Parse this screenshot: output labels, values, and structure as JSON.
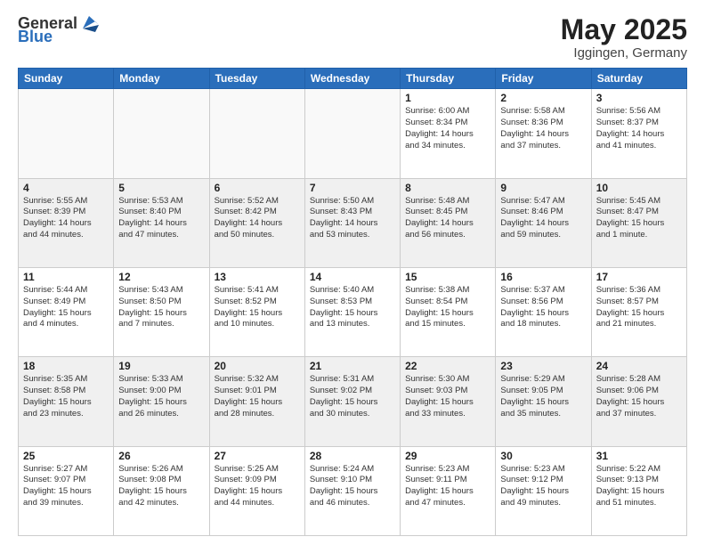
{
  "header": {
    "logo_general": "General",
    "logo_blue": "Blue",
    "title": "May 2025",
    "location": "Iggingen, Germany"
  },
  "days_of_week": [
    "Sunday",
    "Monday",
    "Tuesday",
    "Wednesday",
    "Thursday",
    "Friday",
    "Saturday"
  ],
  "weeks": [
    [
      {
        "day": "",
        "empty": true
      },
      {
        "day": "",
        "empty": true
      },
      {
        "day": "",
        "empty": true
      },
      {
        "day": "",
        "empty": true
      },
      {
        "day": "1",
        "sunrise": "6:00 AM",
        "sunset": "8:34 PM",
        "daylight": "14 hours and 34 minutes."
      },
      {
        "day": "2",
        "sunrise": "5:58 AM",
        "sunset": "8:36 PM",
        "daylight": "14 hours and 37 minutes."
      },
      {
        "day": "3",
        "sunrise": "5:56 AM",
        "sunset": "8:37 PM",
        "daylight": "14 hours and 41 minutes."
      }
    ],
    [
      {
        "day": "4",
        "sunrise": "5:55 AM",
        "sunset": "8:39 PM",
        "daylight": "14 hours and 44 minutes."
      },
      {
        "day": "5",
        "sunrise": "5:53 AM",
        "sunset": "8:40 PM",
        "daylight": "14 hours and 47 minutes."
      },
      {
        "day": "6",
        "sunrise": "5:52 AM",
        "sunset": "8:42 PM",
        "daylight": "14 hours and 50 minutes."
      },
      {
        "day": "7",
        "sunrise": "5:50 AM",
        "sunset": "8:43 PM",
        "daylight": "14 hours and 53 minutes."
      },
      {
        "day": "8",
        "sunrise": "5:48 AM",
        "sunset": "8:45 PM",
        "daylight": "14 hours and 56 minutes."
      },
      {
        "day": "9",
        "sunrise": "5:47 AM",
        "sunset": "8:46 PM",
        "daylight": "14 hours and 59 minutes."
      },
      {
        "day": "10",
        "sunrise": "5:45 AM",
        "sunset": "8:47 PM",
        "daylight": "15 hours and 1 minute."
      }
    ],
    [
      {
        "day": "11",
        "sunrise": "5:44 AM",
        "sunset": "8:49 PM",
        "daylight": "15 hours and 4 minutes."
      },
      {
        "day": "12",
        "sunrise": "5:43 AM",
        "sunset": "8:50 PM",
        "daylight": "15 hours and 7 minutes."
      },
      {
        "day": "13",
        "sunrise": "5:41 AM",
        "sunset": "8:52 PM",
        "daylight": "15 hours and 10 minutes."
      },
      {
        "day": "14",
        "sunrise": "5:40 AM",
        "sunset": "8:53 PM",
        "daylight": "15 hours and 13 minutes."
      },
      {
        "day": "15",
        "sunrise": "5:38 AM",
        "sunset": "8:54 PM",
        "daylight": "15 hours and 15 minutes."
      },
      {
        "day": "16",
        "sunrise": "5:37 AM",
        "sunset": "8:56 PM",
        "daylight": "15 hours and 18 minutes."
      },
      {
        "day": "17",
        "sunrise": "5:36 AM",
        "sunset": "8:57 PM",
        "daylight": "15 hours and 21 minutes."
      }
    ],
    [
      {
        "day": "18",
        "sunrise": "5:35 AM",
        "sunset": "8:58 PM",
        "daylight": "15 hours and 23 minutes."
      },
      {
        "day": "19",
        "sunrise": "5:33 AM",
        "sunset": "9:00 PM",
        "daylight": "15 hours and 26 minutes."
      },
      {
        "day": "20",
        "sunrise": "5:32 AM",
        "sunset": "9:01 PM",
        "daylight": "15 hours and 28 minutes."
      },
      {
        "day": "21",
        "sunrise": "5:31 AM",
        "sunset": "9:02 PM",
        "daylight": "15 hours and 30 minutes."
      },
      {
        "day": "22",
        "sunrise": "5:30 AM",
        "sunset": "9:03 PM",
        "daylight": "15 hours and 33 minutes."
      },
      {
        "day": "23",
        "sunrise": "5:29 AM",
        "sunset": "9:05 PM",
        "daylight": "15 hours and 35 minutes."
      },
      {
        "day": "24",
        "sunrise": "5:28 AM",
        "sunset": "9:06 PM",
        "daylight": "15 hours and 37 minutes."
      }
    ],
    [
      {
        "day": "25",
        "sunrise": "5:27 AM",
        "sunset": "9:07 PM",
        "daylight": "15 hours and 39 minutes."
      },
      {
        "day": "26",
        "sunrise": "5:26 AM",
        "sunset": "9:08 PM",
        "daylight": "15 hours and 42 minutes."
      },
      {
        "day": "27",
        "sunrise": "5:25 AM",
        "sunset": "9:09 PM",
        "daylight": "15 hours and 44 minutes."
      },
      {
        "day": "28",
        "sunrise": "5:24 AM",
        "sunset": "9:10 PM",
        "daylight": "15 hours and 46 minutes."
      },
      {
        "day": "29",
        "sunrise": "5:23 AM",
        "sunset": "9:11 PM",
        "daylight": "15 hours and 47 minutes."
      },
      {
        "day": "30",
        "sunrise": "5:23 AM",
        "sunset": "9:12 PM",
        "daylight": "15 hours and 49 minutes."
      },
      {
        "day": "31",
        "sunrise": "5:22 AM",
        "sunset": "9:13 PM",
        "daylight": "15 hours and 51 minutes."
      }
    ]
  ]
}
